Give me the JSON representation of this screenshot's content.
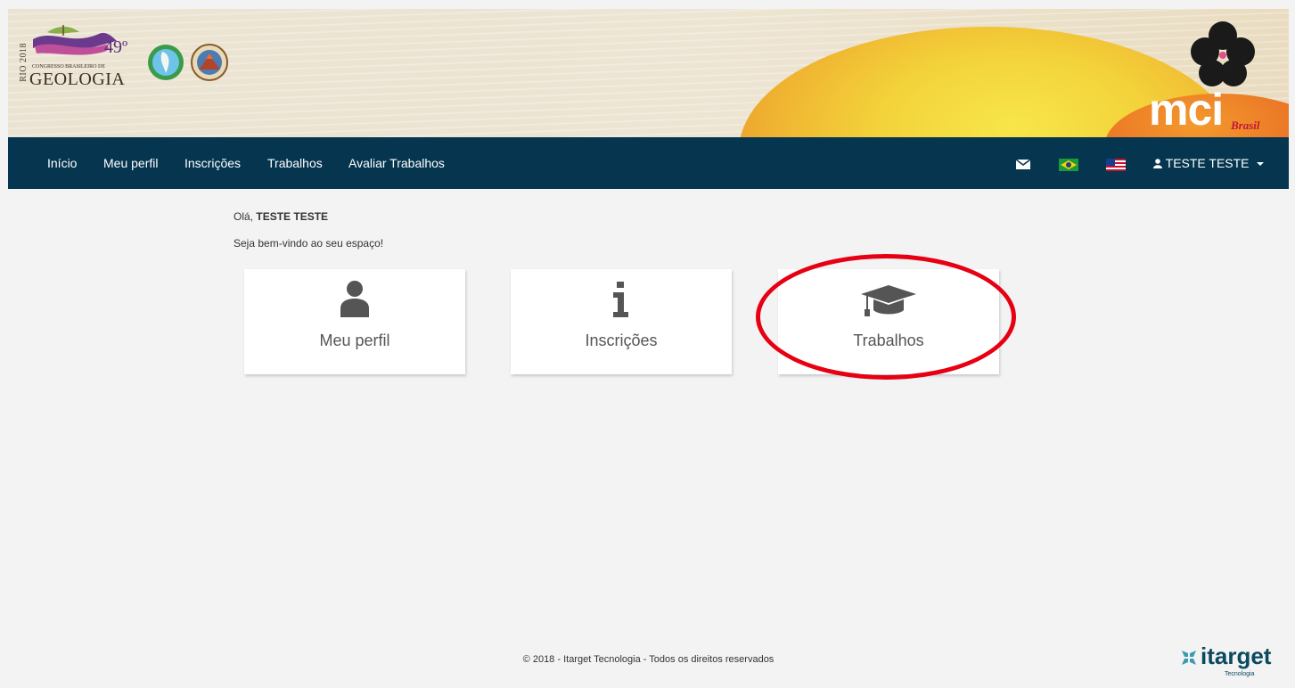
{
  "banner": {
    "event_year": "RIO 2018",
    "event_edition": "49º",
    "event_subtitle": "CONGRESSO BRASILEIRO DE",
    "event_title": "GEOLOGIA",
    "organizer_logo_text": "mci",
    "organizer_logo_subtext": "Brasil"
  },
  "nav": {
    "items": [
      {
        "label": "Início"
      },
      {
        "label": "Meu perfil"
      },
      {
        "label": "Inscrições"
      },
      {
        "label": "Trabalhos"
      },
      {
        "label": "Avaliar Trabalhos"
      }
    ],
    "user_label": "TESTE TESTE",
    "icons": [
      "envelope-icon",
      "brazil-flag-icon",
      "us-flag-icon",
      "user-icon",
      "caret-down-icon"
    ]
  },
  "main": {
    "greeting_prefix": "Olá,",
    "user_name": "TESTE TESTE",
    "welcome": "Seja bem-vindo ao seu espaço!",
    "cards": [
      {
        "label": "Meu perfil",
        "icon": "user-icon"
      },
      {
        "label": "Inscrições",
        "icon": "info-icon"
      },
      {
        "label": "Trabalhos",
        "icon": "graduation-cap-icon"
      }
    ],
    "highlight_color": "#e60012"
  },
  "footer": {
    "copyright": "© 2018 - Itarget Tecnologia - Todos os direitos reservados",
    "brand": "itarget",
    "brand_sub": "Tecnologia"
  },
  "colors": {
    "navbar": "#05354f",
    "background": "#f3f3f3",
    "card_icon": "#555555"
  }
}
